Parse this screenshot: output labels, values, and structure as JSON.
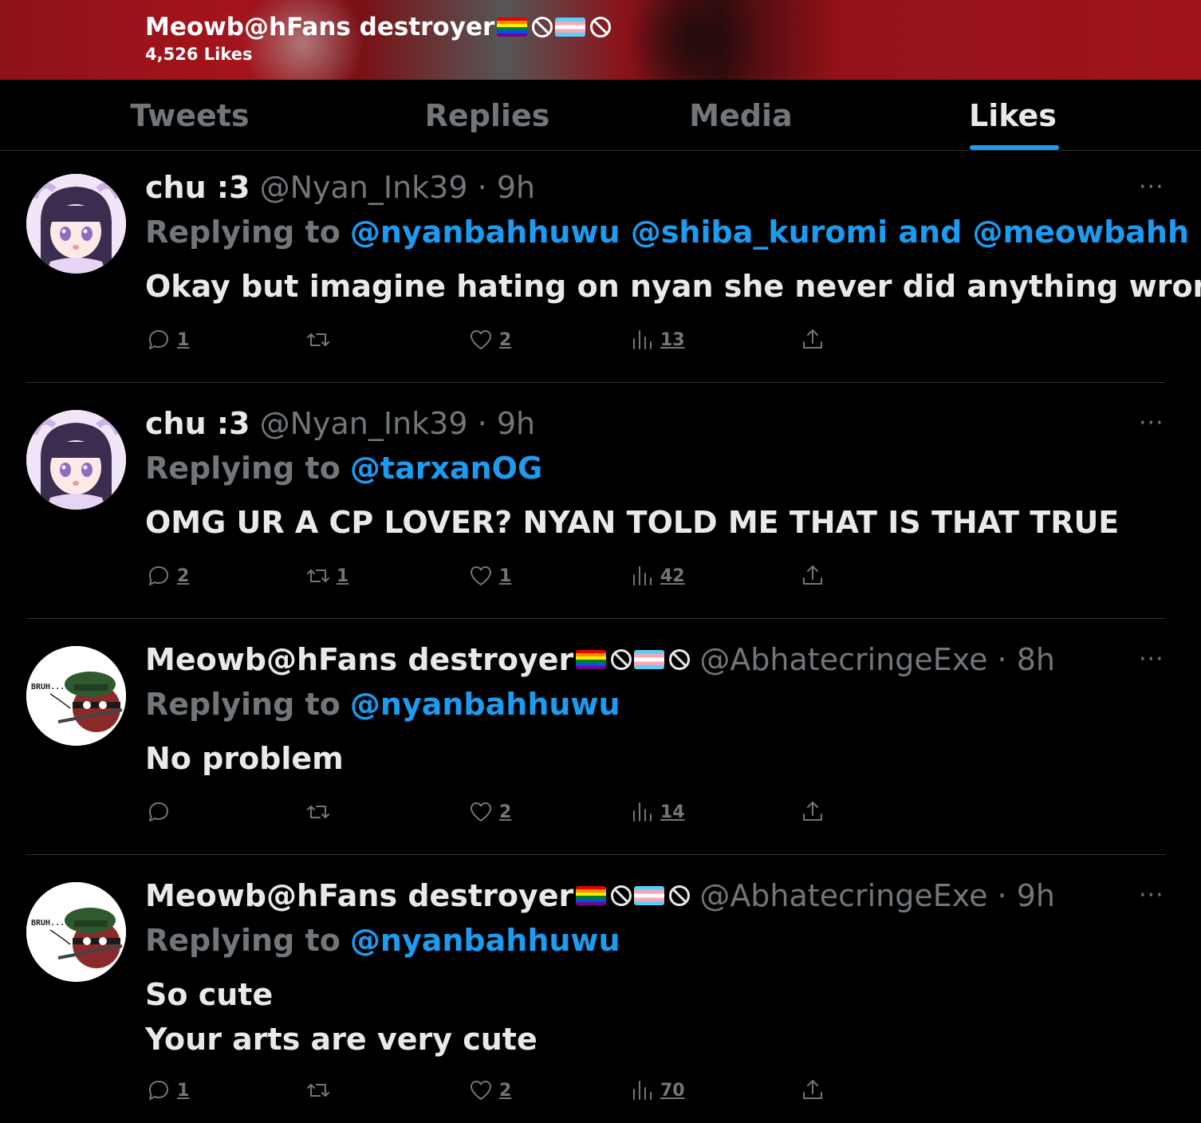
{
  "profile": {
    "name": "Meowb@hFans destroyer",
    "likes_count": "4,526 Likes"
  },
  "tabs": [
    {
      "label": "Tweets",
      "active": false
    },
    {
      "label": "Replies",
      "active": false
    },
    {
      "label": "Media",
      "active": false
    },
    {
      "label": "Likes",
      "active": true
    }
  ],
  "colors": {
    "accent": "#1d9bf0",
    "muted": "#71767b",
    "text": "#e7e9ea",
    "banner": "#a5141c"
  },
  "tweets": [
    {
      "name": "chu :3",
      "handle": "@Nyan_Ink39",
      "dot": "·",
      "time": "9h",
      "replying_prefix": "Replying to",
      "replying_mentions": "@nyanbahhuwu @shiba_kuromi and @meowbahh",
      "text_lines": [
        "Okay but imagine hating on nyan she never did anything wrong?"
      ],
      "replies": "1",
      "retweets": "",
      "likes": "2",
      "views": "13",
      "more": "···"
    },
    {
      "name": "chu :3",
      "handle": "@Nyan_Ink39",
      "dot": "·",
      "time": "9h",
      "replying_prefix": "Replying to",
      "replying_mentions": "@tarxanOG",
      "text_lines": [
        "OMG UR A CP LOVER? NYAN TOLD ME THAT IS THAT TRUE"
      ],
      "replies": "2",
      "retweets": "1",
      "likes": "1",
      "views": "42",
      "more": "···"
    },
    {
      "name": "Meowb@hFans destroyer",
      "handle": "@AbhatecringeExe",
      "dot": "·",
      "time": "8h",
      "replying_prefix": "Replying to",
      "replying_mentions": "@nyanbahhuwu",
      "text_lines": [
        "No problem"
      ],
      "replies": "",
      "retweets": "",
      "likes": "2",
      "views": "14",
      "more": "···"
    },
    {
      "name": "Meowb@hFans destroyer",
      "handle": "@AbhatecringeExe",
      "dot": "·",
      "time": "9h",
      "replying_prefix": "Replying to",
      "replying_mentions": "@nyanbahhuwu",
      "text_lines": [
        "So cute",
        "Your arts are very cute"
      ],
      "replies": "1",
      "retweets": "",
      "likes": "2",
      "views": "70",
      "more": "···"
    }
  ],
  "avatar_text": "BRUH..."
}
